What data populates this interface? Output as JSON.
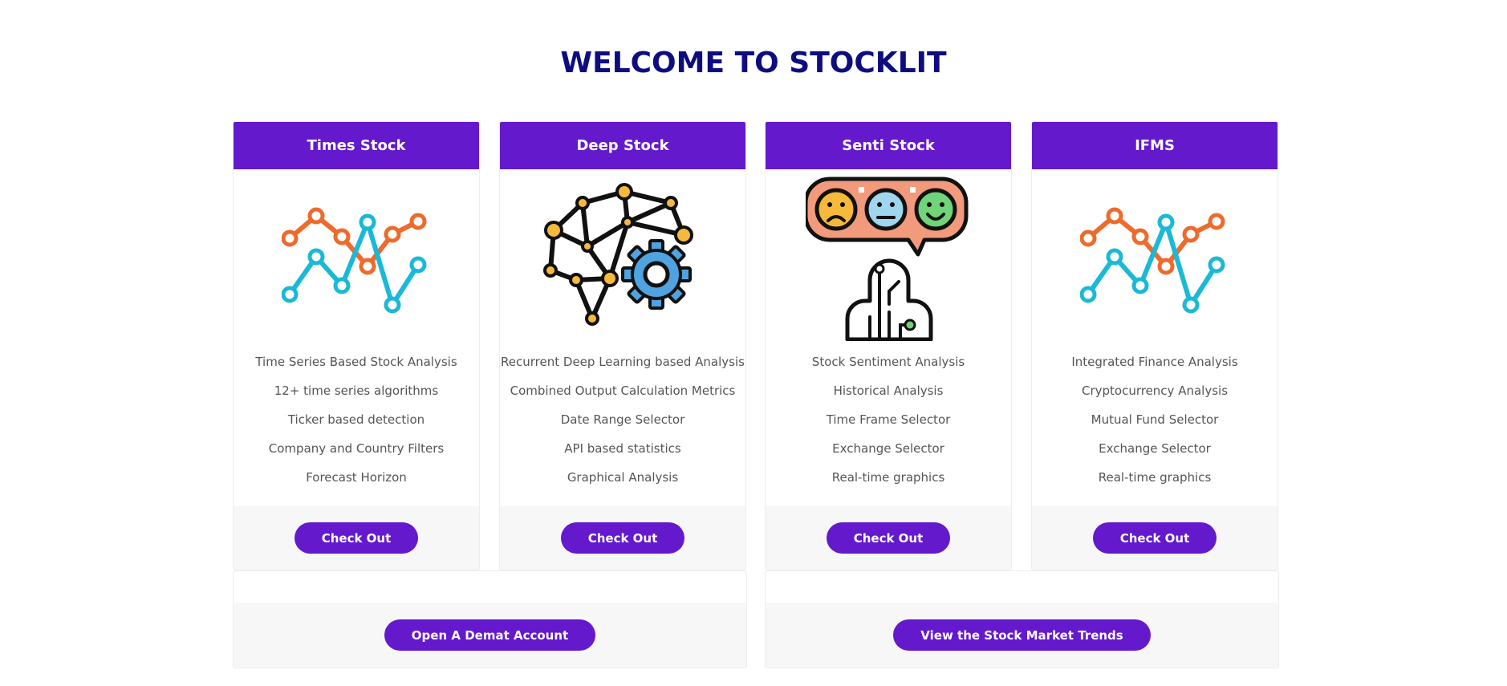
{
  "page": {
    "title": "WELCOME TO STOCKLIT"
  },
  "colors": {
    "brand": "#6419cc",
    "title": "#0d0d80",
    "orange": "#ec6b2d",
    "cyan": "#1ab9d6",
    "yellow": "#f6b93b",
    "gear_blue": "#4ea3e0"
  },
  "cards": [
    {
      "title": "Times Stock",
      "icon": "line-chart-icon",
      "features": [
        "Time Series Based Stock Analysis",
        "12+ time series algorithms",
        "Ticker based detection",
        "Company and Country Filters",
        "Forecast Horizon"
      ],
      "button": "Check Out"
    },
    {
      "title": "Deep Stock",
      "icon": "neural-brain-gear-icon",
      "features": [
        "Recurrent Deep Learning based Analysis",
        "Combined Output Calculation Metrics",
        "Date Range Selector",
        "API based statistics",
        "Graphical Analysis"
      ],
      "button": "Check Out"
    },
    {
      "title": "Senti Stock",
      "icon": "sentiment-robot-icon",
      "features": [
        "Stock Sentiment Analysis",
        "Historical Analysis",
        "Time Frame Selector",
        "Exchange Selector",
        "Real-time graphics"
      ],
      "button": "Check Out"
    },
    {
      "title": "IFMS",
      "icon": "line-chart-icon",
      "features": [
        "Integrated Finance Analysis",
        "Cryptocurrency Analysis",
        "Mutual Fund Selector",
        "Exchange Selector",
        "Real-time graphics"
      ],
      "button": "Check Out"
    }
  ],
  "actions": {
    "demat_button": "Open A Demat Account",
    "trends_button": "View the Stock Market Trends"
  }
}
